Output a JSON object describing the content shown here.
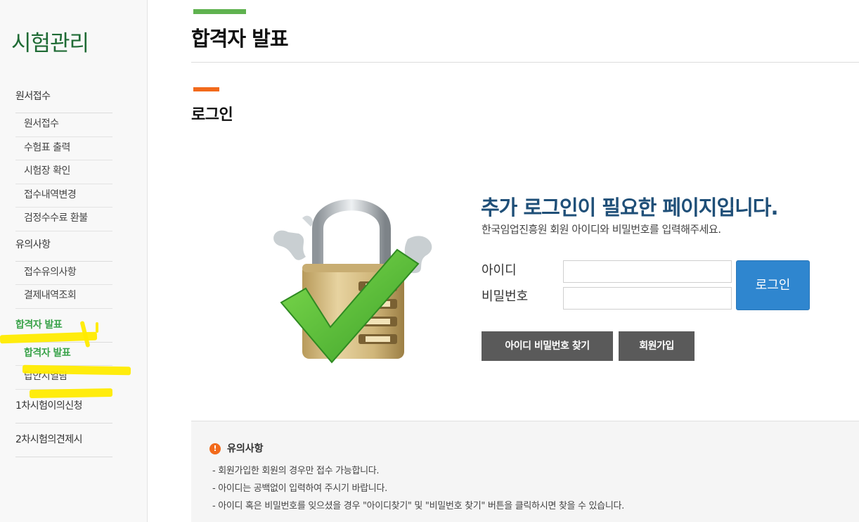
{
  "sidebar": {
    "title": "시험관리",
    "groups": [
      {
        "label": "원서접수",
        "items": [
          "원서접수",
          "수험표 출력",
          "시험장 확인",
          "접수내역변경",
          "검정수수료 환불"
        ]
      },
      {
        "label": "유의사항",
        "items": [
          "접수유의사항",
          "결제내역조회"
        ]
      },
      {
        "label": "합격자 발표",
        "items": [
          "합격자 발표",
          "답안지열람"
        ]
      },
      {
        "label": "1차시험이의신청",
        "items": []
      },
      {
        "label": "2차시험의견제시",
        "items": []
      }
    ]
  },
  "header": {
    "title": "합격자 발표"
  },
  "section": {
    "title": "로그인"
  },
  "login": {
    "headline": "추가 로그인이 필요한 페이지입니다.",
    "description": "한국임업진흥원 회원 아이디와 비밀번호를 입력해주세요.",
    "id_label": "아이디",
    "pw_label": "비밀번호",
    "id_value": "",
    "pw_value": "",
    "login_button": "로그인",
    "find_button": "아이디 비밀번호 찾기",
    "join_button": "회원가입"
  },
  "notice": {
    "title": "유의사항",
    "items": [
      "- 회원가입한 회원의 경우만 접수 가능합니다.",
      "- 아이디는 공백없이 입력하여 주시기 바랍니다.",
      "- 아이디 혹은 비밀번호를 잊으셨을 경우 \"아이디찾기\" 및 \"비밀번호 찾기\" 버튼을 클릭하시면 찾을 수 있습니다."
    ]
  },
  "colors": {
    "brand_green": "#1f6b35",
    "accent_green": "#5fb24f",
    "accent_orange": "#f26a1b",
    "headline_blue": "#1f4f78",
    "button_blue": "#2f86cf"
  }
}
